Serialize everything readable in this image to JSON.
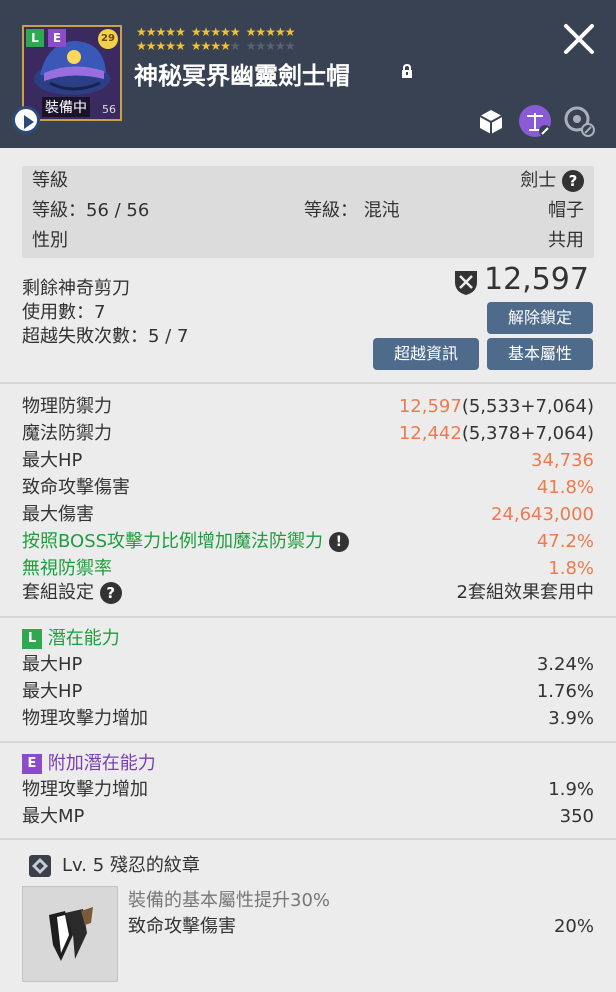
{
  "header": {
    "badge_l": "L",
    "badge_e": "E",
    "level_badge": "29",
    "equipped_label": "裝備中",
    "item_number": "56",
    "item_name": "神秘冥界幽靈劍士帽",
    "stars_total": 30,
    "stars_lit": 24
  },
  "requirements": {
    "job_label": "等級",
    "job_value": "劍士",
    "level_label": "等級：56 / 56",
    "tier_label": "等級： 混沌",
    "category_value": "帽子",
    "gender_label": "性別",
    "gender_value": "共用"
  },
  "scissors": {
    "remaining_label": "剩餘神奇剪刀",
    "uses_label": "使用數：7",
    "fail_label": "超越失敗次數：5 / 7",
    "power_value": "12,597",
    "unlock_button": "解除鎖定",
    "transcend_button": "超越資訊",
    "base_stat_button": "基本屬性"
  },
  "stats": [
    {
      "label": "物理防禦力",
      "value": "12,597",
      "extra": "(5,533+7,064)"
    },
    {
      "label": "魔法防禦力",
      "value": "12,442",
      "extra": "(5,378+7,064)"
    },
    {
      "label": "最大HP",
      "value": "34,736",
      "extra": ""
    },
    {
      "label": "致命攻擊傷害",
      "value": "41.8%",
      "extra": ""
    },
    {
      "label": "最大傷害",
      "value": "24,643,000",
      "extra": ""
    },
    {
      "label": "按照BOSS攻擊力比例增加魔法防禦力",
      "value": "47.2%",
      "extra": ""
    },
    {
      "label": "無視防禦率",
      "value": "1.8%",
      "extra": ""
    }
  ],
  "set_effect": {
    "label": "套組設定",
    "value": "2套組效果套用中"
  },
  "potential": {
    "tier": "L",
    "title": "潛在能力",
    "lines": [
      {
        "label": "最大HP",
        "value": "3.24%"
      },
      {
        "label": "最大HP",
        "value": "1.76%"
      },
      {
        "label": "物理攻擊力增加",
        "value": "3.9%"
      }
    ]
  },
  "additional_potential": {
    "tier": "E",
    "title": "附加潛在能力",
    "lines": [
      {
        "label": "物理攻擊力增加",
        "value": "1.9%"
      },
      {
        "label": "最大MP",
        "value": "350"
      }
    ]
  },
  "emblem": {
    "title": "Lv. 5 殘忍的紋章",
    "description": "裝備的基本屬性提升30%",
    "stat_label": "致命攻擊傷害",
    "stat_value": "20%"
  },
  "colors": {
    "header_bg": "#394252",
    "panel_bg": "#ececec",
    "accent_orange": "#f07a4e",
    "accent_green": "#1d9e3e",
    "button_blue": "#4f6b8c"
  }
}
